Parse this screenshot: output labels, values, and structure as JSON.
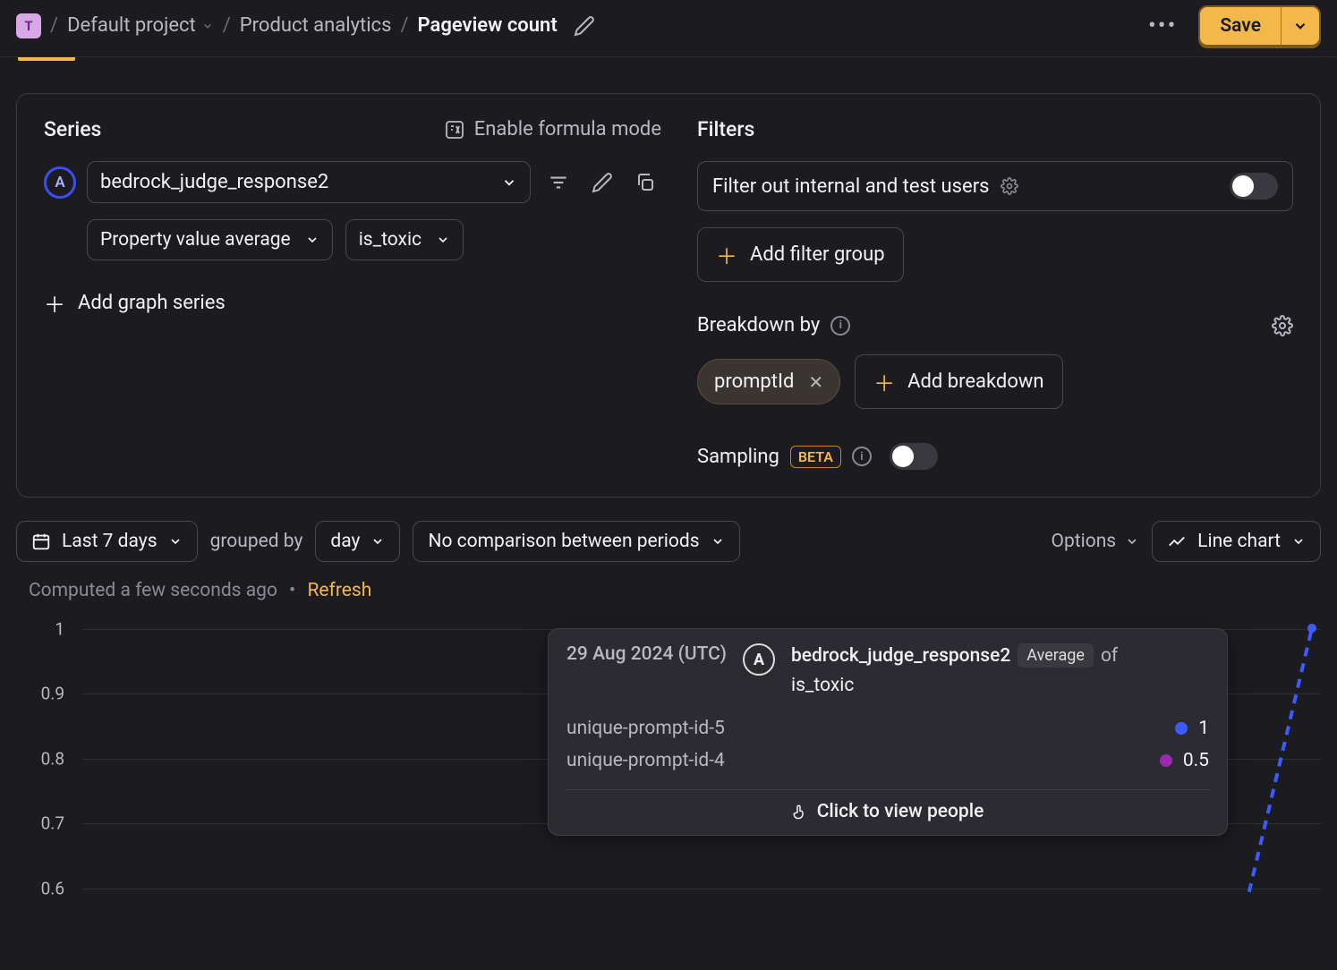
{
  "breadcrumbs": {
    "project_badge": "T",
    "project": "Default project",
    "section": "Product analytics",
    "page": "Pageview count"
  },
  "topbar": {
    "save": "Save"
  },
  "series": {
    "title": "Series",
    "formula_link": "Enable formula mode",
    "marker": "A",
    "event": "bedrock_judge_response2",
    "agg": "Property value average",
    "prop": "is_toxic",
    "add": "Add graph series"
  },
  "filters": {
    "title": "Filters",
    "row1": "Filter out internal and test users",
    "add_group": "Add filter group"
  },
  "breakdown": {
    "title": "Breakdown by",
    "chip": "promptId",
    "add": "Add breakdown"
  },
  "sampling": {
    "title": "Sampling",
    "badge": "BETA"
  },
  "controls": {
    "range": "Last 7 days",
    "grouped_by": "grouped by",
    "interval": "day",
    "compare": "No comparison between periods",
    "options": "Options",
    "chart_type": "Line chart"
  },
  "computed": {
    "text": "Computed a few seconds ago",
    "refresh": "Refresh"
  },
  "chart_data": {
    "type": "line",
    "ylabel": "",
    "ylim": [
      0.6,
      1.0
    ],
    "yticks": [
      0.6,
      0.7,
      0.8,
      0.9,
      1.0
    ],
    "hover_date": "29 Aug 2024 (UTC)",
    "series_event": "bedrock_judge_response2",
    "series_agg": "Average",
    "series_of": "of",
    "series_prop": "is_toxic",
    "series": [
      {
        "name": "unique-prompt-id-5",
        "color": "#3d5afe",
        "value_at_hover": 1
      },
      {
        "name": "unique-prompt-id-4",
        "color": "#9c27b0",
        "value_at_hover": 0.5
      }
    ],
    "tooltip_footer": "Click to view people"
  }
}
